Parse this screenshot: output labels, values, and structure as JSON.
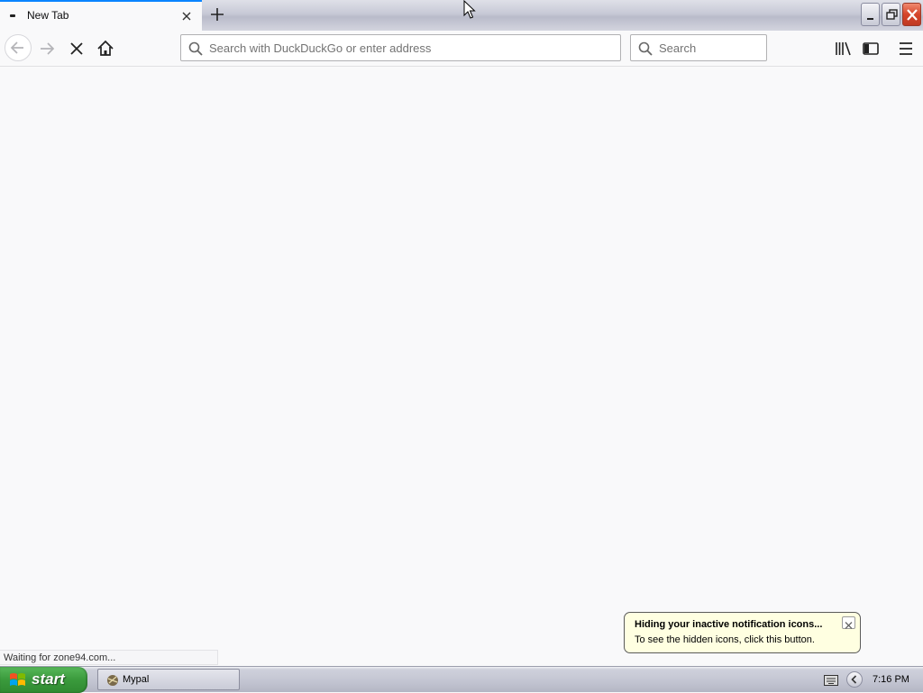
{
  "browser": {
    "tab": {
      "title": "New Tab"
    },
    "urlbar": {
      "placeholder": "Search with DuckDuckGo or enter address"
    },
    "searchbar": {
      "placeholder": "Search"
    },
    "status": "Waiting for zone94.com..."
  },
  "notification": {
    "title": "Hiding your inactive notification icons...",
    "text": "To see the hidden icons, click this button."
  },
  "taskbar": {
    "start_label": "start",
    "tasks": [
      {
        "label": "Mypal"
      }
    ],
    "clock": "7:16 PM"
  },
  "icons": {
    "tab": "page-dash-icon",
    "back": "arrow-left-icon",
    "forward": "arrow-right-icon",
    "stop": "x-stop-icon",
    "home": "home-icon",
    "library": "library-icon",
    "sidebar": "sidebar-icon",
    "menu": "hamburger-icon"
  },
  "colors": {
    "accent": "#0a84ff",
    "start_green": "#3a9a3c",
    "balloon_bg": "#ffffe1",
    "close_red": "#d5442a"
  }
}
